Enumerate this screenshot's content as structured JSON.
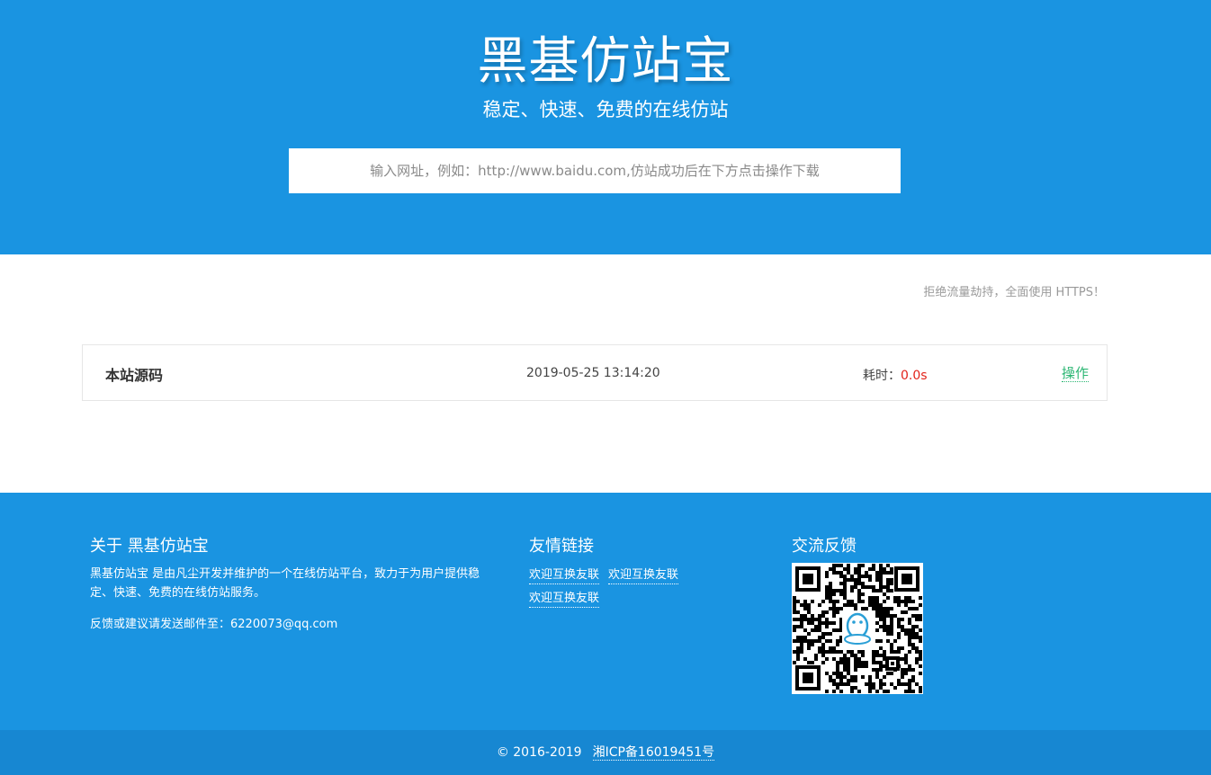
{
  "hero": {
    "title": "黑基仿站宝",
    "subtitle": "稳定、快速、免费的在线仿站",
    "url_placeholder": "输入网址，例如：http://www.baidu.com,仿站成功后在下方点击操作下载"
  },
  "notice": "拒绝流量劫持，全面使用 HTTPS！",
  "result": {
    "name": "本站源码",
    "time": "2019-05-25 13:14:20",
    "cost_label": "耗时：",
    "cost_value": "0.0s",
    "action": "操作"
  },
  "footer": {
    "about": {
      "title": "关于 黑基仿站宝",
      "text": "黑基仿站宝 是由凡尘开发并维护的一个在线仿站平台，致力于为用户提供稳定、快速、免费的在线仿站服务。",
      "feedback": "反馈或建议请发送邮件至：6220073@qq.com"
    },
    "links": {
      "title": "友情链接",
      "items": [
        "欢迎互换友联",
        "欢迎互换友联",
        "欢迎互换友联"
      ]
    },
    "contact": {
      "title": "交流反馈",
      "qr_icon": "qq-qr-code-icon"
    }
  },
  "bottom": {
    "copyright": "© 2016-2019",
    "icp": "湘ICP备16019451号"
  },
  "colors": {
    "primary": "#1a94e1",
    "bottom_bar": "#1787d2",
    "action": "#2bb673",
    "cost_value": "#e2231a"
  }
}
